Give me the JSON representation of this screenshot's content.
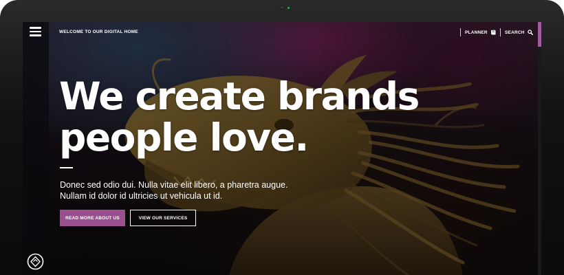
{
  "colors": {
    "accent": "#9a4f8f",
    "scrollbar_thumb": "#a35aa0",
    "text": "#ffffff",
    "bezel": "#121212"
  },
  "header": {
    "menu_icon": "hamburger-menu-icon",
    "welcome_text": "WELCOME TO OUR DIGITAL HOME",
    "planner": {
      "label": "PLANNER",
      "icon": "book-icon"
    },
    "search": {
      "label": "SEARCH",
      "icon": "search-icon"
    }
  },
  "hero": {
    "headline_line1": "We create brands",
    "headline_line2": "people love.",
    "body_line1": "Donec sed odio dui. Nulla vitae elit libero, a pharetra augue.",
    "body_line2": "Nullam id dolor id ultricies ut vehicula ut id.",
    "primary_button": "READ MORE ABOUT US",
    "secondary_button": "VIEW OUR SERVICES"
  },
  "footer": {
    "logo_icon": "brand-logo-icon"
  }
}
